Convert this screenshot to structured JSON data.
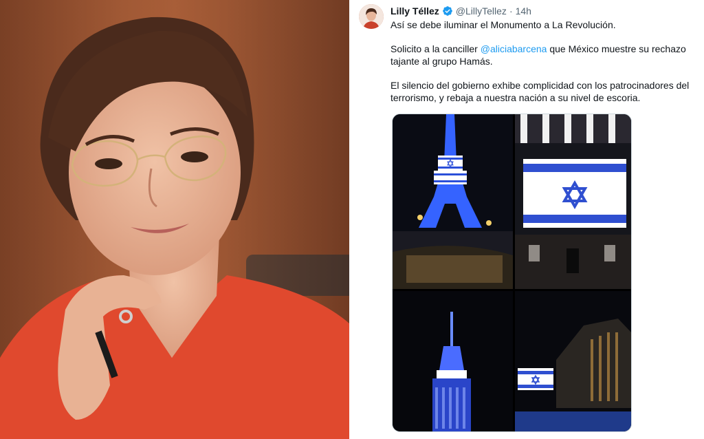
{
  "tweet": {
    "display_name": "Lilly Téllez",
    "handle": "@LillyTellez",
    "separator": "·",
    "time": "14h",
    "line1": "Así se debe iluminar el Monumento a La Revolución.",
    "line2_before": "Solicito a la canciller ",
    "mention": "@aliciabarcena",
    "line2_after": " que México muestre su rechazo tajante al grupo Hamás.",
    "line3": "El silencio del gobierno exhibe complicidad con los patrocinadores del terrorismo, y rebaja a nuestra nación a su nivel de escoria."
  },
  "colors": {
    "accent": "#1d9bf0",
    "text": "#0f1419",
    "muted": "#536471",
    "verified": "#1d9bf0",
    "portrait_background": "#9b5533",
    "blouse": "#e0492e"
  },
  "icons": {
    "verified": "verified-badge-icon",
    "flag": "star-of-david-flag"
  }
}
